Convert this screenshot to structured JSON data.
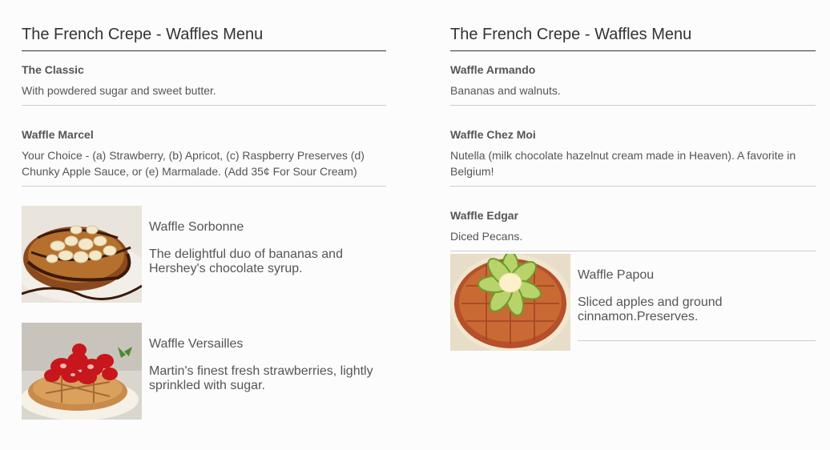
{
  "left": {
    "title": "The French Crepe - Waffles Menu",
    "items": [
      {
        "name": "The Classic",
        "desc": "With powdered sugar and sweet butter."
      },
      {
        "name": "Waffle Marcel",
        "desc": "Your Choice - (a) Strawberry, (b) Apricot, (c) Raspberry Preserves (d) Chunky Apple Sauce, or (e) Marmalade. (Add 35¢ For Sour Cream)"
      },
      {
        "name": "Waffle Sorbonne",
        "desc": "The delightful duo of bananas and Hershey's chocolate syrup.",
        "image": "waffle-banana-chocolate-photo"
      },
      {
        "name": "Waffle Versailles",
        "desc": "Martin's finest fresh strawberries, lightly sprinkled with sugar.",
        "image": "waffle-strawberry-photo"
      }
    ]
  },
  "right": {
    "title": "The French Crepe - Waffles Menu",
    "items": [
      {
        "name": "Waffle Armando",
        "desc": "Bananas and walnuts."
      },
      {
        "name": "Waffle Chez Moi",
        "desc": "Nutella (milk chocolate hazelnut cream made in Heaven). A favorite in Belgium!"
      },
      {
        "name": "Waffle Edgar",
        "desc": "Diced Pecans."
      },
      {
        "name": "Waffle Papou",
        "desc": "Sliced apples and ground cinnamon.Preserves.",
        "image": "waffle-apple-photo"
      }
    ]
  },
  "colors": {
    "text": "#555555",
    "title": "#333333",
    "divider": "#cccccc",
    "background": "#fcfcfc"
  }
}
